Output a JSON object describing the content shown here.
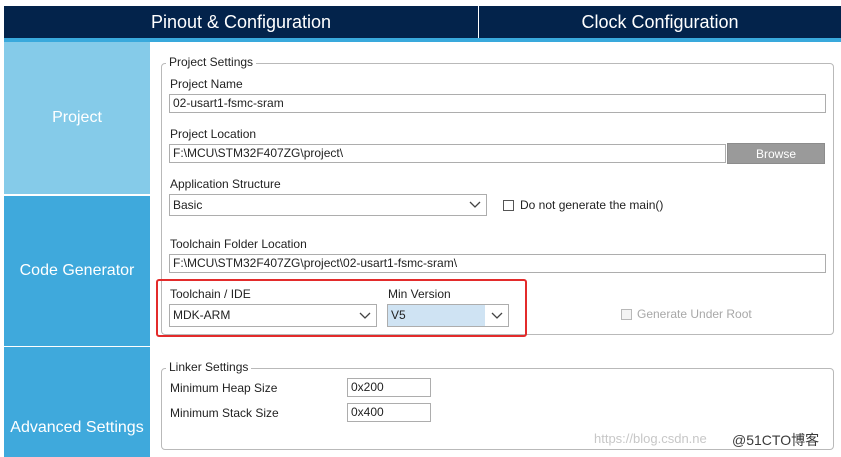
{
  "tabs": {
    "pinout": "Pinout & Configuration",
    "clock": "Clock Configuration"
  },
  "sidebar": {
    "project": "Project",
    "code_generator": "Code Generator",
    "advanced": "Advanced Settings"
  },
  "project_settings": {
    "legend": "Project Settings",
    "name_label": "Project Name",
    "name_value": "02-usart1-fsmc-sram",
    "location_label": "Project Location",
    "location_value": "F:\\MCU\\STM32F407ZG\\project\\",
    "browse_label": "Browse",
    "app_structure_label": "Application Structure",
    "app_structure_value": "Basic",
    "no_main_label": "Do not generate the main()",
    "toolchain_folder_label": "Toolchain Folder Location",
    "toolchain_folder_value": "F:\\MCU\\STM32F407ZG\\project\\02-usart1-fsmc-sram\\",
    "toolchain_label": "Toolchain / IDE",
    "toolchain_value": "MDK-ARM",
    "min_version_label": "Min Version",
    "min_version_value": "V5",
    "generate_root_label": "Generate Under Root"
  },
  "linker_settings": {
    "legend": "Linker Settings",
    "heap_label": "Minimum Heap Size",
    "heap_value": "0x200",
    "stack_label": "Minimum Stack Size",
    "stack_value": "0x400"
  },
  "watermark": {
    "url": "https://blog.csdn.ne",
    "brand": "@51CTO博客"
  },
  "colors": {
    "header": "#03234b",
    "accent": "#3fa9dc",
    "sidebar_active": "#85cbe9",
    "highlight": "#e32b2b"
  }
}
